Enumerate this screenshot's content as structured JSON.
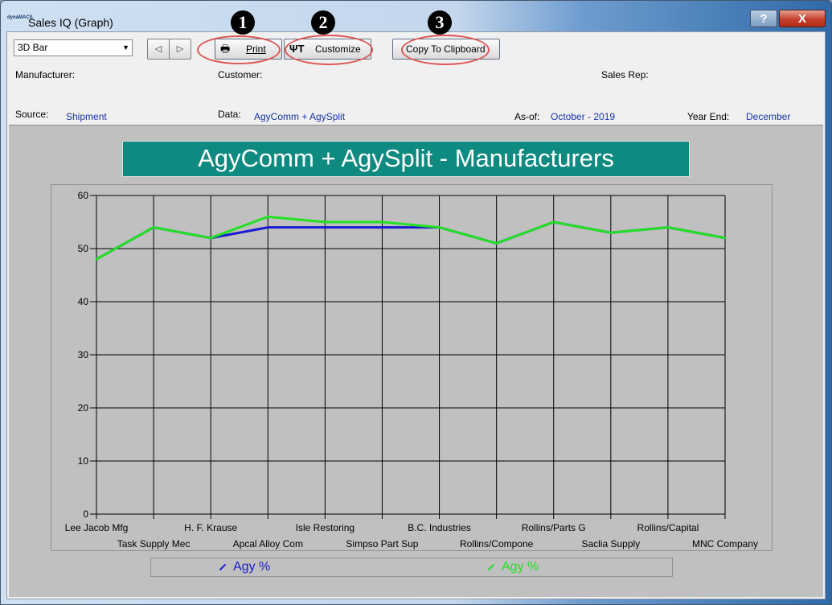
{
  "window": {
    "title": "Sales IQ (Graph)",
    "icon_text": "dynaMACS"
  },
  "titlebar": {
    "help_label": "?",
    "close_label": "X"
  },
  "toolbar": {
    "chart_type": "3D Bar",
    "print_label": "Print",
    "customize_label": "Customize",
    "clipboard_label": "Copy To Clipboard",
    "callouts": [
      "1",
      "2",
      "3"
    ]
  },
  "filters": {
    "manufacturer_label": "Manufacturer:",
    "customer_label": "Customer:",
    "sales_rep_label": "Sales Rep:",
    "source_label": "Source:",
    "source_value": "Shipment",
    "data_label": "Data:",
    "data_value": "AgyComm + AgySplit",
    "asof_label": "As-of:",
    "asof_value": "October - 2019",
    "yearend_label": "Year End:",
    "yearend_value": "December"
  },
  "colors": {
    "series_blue": "#1a1ad0",
    "series_green": "#22e022",
    "title_bg": "#0e8a80",
    "annotation_red": "#e05555"
  },
  "chart_data": {
    "type": "line",
    "title": "AgyComm + AgySplit - Manufacturers",
    "xlabel": "",
    "ylabel": "",
    "ylim": [
      0,
      60
    ],
    "yticks": [
      0,
      10,
      20,
      30,
      40,
      50,
      60
    ],
    "grid": true,
    "legend_position": "bottom",
    "categories": [
      "Lee Jacob Mfg",
      "Task Supply Mec",
      "H. F. Krause",
      "Apcal Alloy Com",
      "Isle Restoring",
      "Simpso Part Sup",
      "B.C. Industries",
      "Rollins/Compone",
      "Rollins/Parts G",
      "Saclia Supply",
      "Rollins/Capital",
      "MNC Company"
    ],
    "series": [
      {
        "name": "Agy %",
        "color": "#1a1ad0",
        "values": [
          48,
          54,
          52,
          54,
          54,
          54,
          54,
          51,
          55,
          53,
          54,
          52
        ]
      },
      {
        "name": "Agy %",
        "color": "#22e022",
        "values": [
          48,
          54,
          52,
          56,
          55,
          55,
          54,
          51,
          55,
          53,
          54,
          52
        ]
      }
    ]
  }
}
